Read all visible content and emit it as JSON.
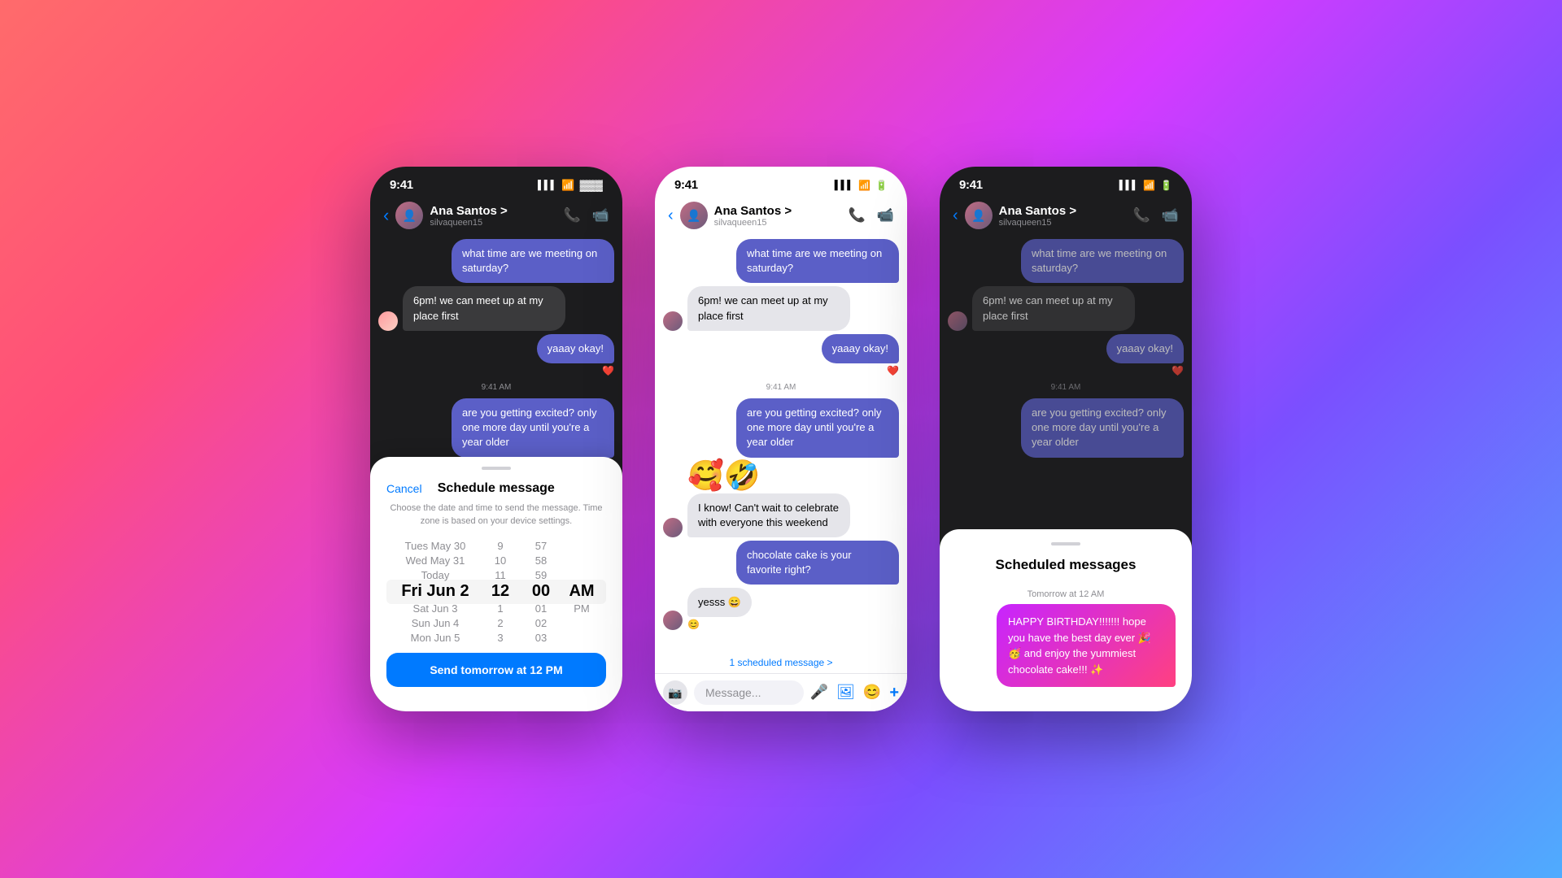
{
  "background": {
    "gradient": "linear-gradient(135deg, #ff6b6b, #ff4e7a, #d63aff, #7b4fff, #4facfe)"
  },
  "phone1": {
    "status_time": "9:41",
    "contact_name": "Ana Santos >",
    "contact_username": "silvaqueen15",
    "messages": [
      {
        "type": "sent",
        "text": "what time are we meeting on saturday?"
      },
      {
        "type": "received",
        "text": "6pm! we can meet up at my place first"
      },
      {
        "type": "sent",
        "text": "yaaay okay!",
        "reaction": "❤️"
      },
      {
        "type": "timestamp",
        "text": "9:41 AM"
      },
      {
        "type": "sent",
        "text": "are you getting excited? only one more day until you're a year older"
      }
    ],
    "sheet": {
      "handle": true,
      "cancel_label": "Cancel",
      "title": "Schedule message",
      "description": "Choose the date and time to send the message. Time zone is based on your device settings.",
      "picker": {
        "date_col": [
          "Tues May 30",
          "Wed May 31",
          "Today",
          "Fri Jun 2",
          "Sat Jun 3",
          "Sun Jun 4",
          "Mon Jun 5"
        ],
        "hour_col": [
          "9",
          "10",
          "11",
          "12",
          "1",
          "2",
          "3"
        ],
        "min_col": [
          "57",
          "58",
          "59",
          "00",
          "01",
          "02",
          "03"
        ],
        "ampm_col": [
          "AM",
          "PM"
        ],
        "selected_date": "Fri Jun 2",
        "selected_hour": "12",
        "selected_min": "00",
        "selected_ampm": "AM"
      },
      "send_btn": "Send tomorrow at 12 PM"
    }
  },
  "phone2": {
    "status_time": "9:41",
    "contact_name": "Ana Santos >",
    "contact_username": "silvaqueen15",
    "messages": [
      {
        "type": "sent",
        "text": "what time are we meeting on saturday?"
      },
      {
        "type": "received",
        "text": "6pm! we can meet up at my place first"
      },
      {
        "type": "sent",
        "text": "yaaay okay!",
        "reaction": "❤️"
      },
      {
        "type": "timestamp",
        "text": "9:41 AM"
      },
      {
        "type": "sent",
        "text": "are you getting excited? only one more day until you're a year older"
      },
      {
        "type": "emoji_sticker",
        "text": "🥰🤣"
      },
      {
        "type": "received",
        "text": "I know! Can't wait to celebrate with everyone this weekend"
      },
      {
        "type": "sent",
        "text": "chocolate cake is your favorite right?"
      },
      {
        "type": "received",
        "text": "yesss 😄",
        "reaction": "😊"
      }
    ],
    "scheduled_banner": "1 scheduled message >",
    "input_placeholder": "Message...",
    "nav_icons": [
      "📞",
      "⬜"
    ]
  },
  "phone3": {
    "status_time": "9:41",
    "contact_name": "Ana Santos >",
    "contact_username": "silvaqueen15",
    "messages": [
      {
        "type": "sent",
        "text": "what time are we meeting on saturday?"
      },
      {
        "type": "received",
        "text": "6pm! we can meet up at my place first"
      },
      {
        "type": "sent",
        "text": "yaaay okay!",
        "reaction": "❤️"
      },
      {
        "type": "timestamp",
        "text": "9:41 AM"
      },
      {
        "type": "sent",
        "text": "are you getting excited? only one more day until you're a year older"
      }
    ],
    "panel": {
      "title": "Scheduled messages",
      "msg_time": "Tomorrow at 12 AM",
      "msg_text": "HAPPY BIRTHDAY!!!!!!! hope you have the best day ever 🎉🥳 and enjoy the yummiest chocolate cake!!! ✨"
    }
  },
  "icons": {
    "back": "‹",
    "phone": "📞",
    "video": "⬜",
    "signal_bars": "▌▌▌",
    "wifi": "WiFi",
    "battery": "🔋",
    "mic": "🎤",
    "image": "🖼",
    "emoji": "😊",
    "plus": "+"
  }
}
